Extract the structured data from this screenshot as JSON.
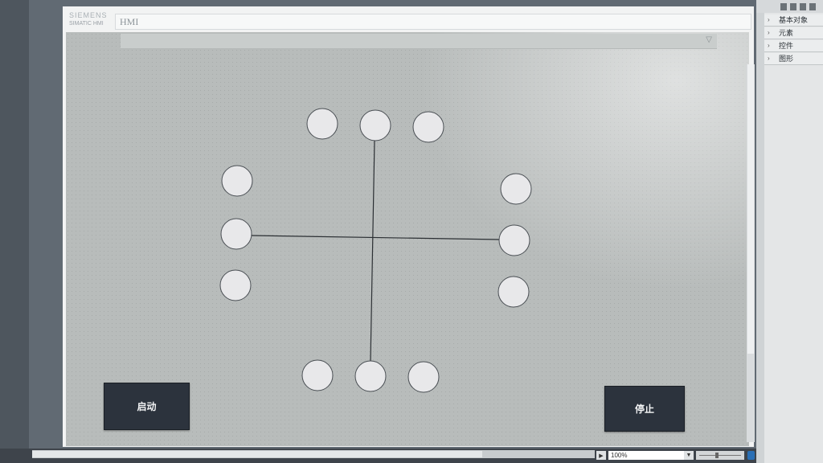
{
  "brand": {
    "line1": "SIEMENS",
    "line2": "SIMATIC HMI"
  },
  "header": {
    "title": "HMI"
  },
  "buttons": {
    "start": "启动",
    "stop": "停止"
  },
  "status": {
    "zoom": "100%"
  },
  "toolbox": {
    "sections": [
      {
        "label": "基本对象"
      },
      {
        "label": "元素"
      },
      {
        "label": "控件"
      },
      {
        "label": "图形"
      }
    ]
  },
  "icons": {
    "collapse": "chevron-down-icon",
    "section_expand": "chevron-right-icon"
  },
  "colors": {
    "screen_bg": "#b8bcbb",
    "button_bg": "#2c333d",
    "circle_fill": "#e8e8ea",
    "line": "#2b2f33"
  }
}
